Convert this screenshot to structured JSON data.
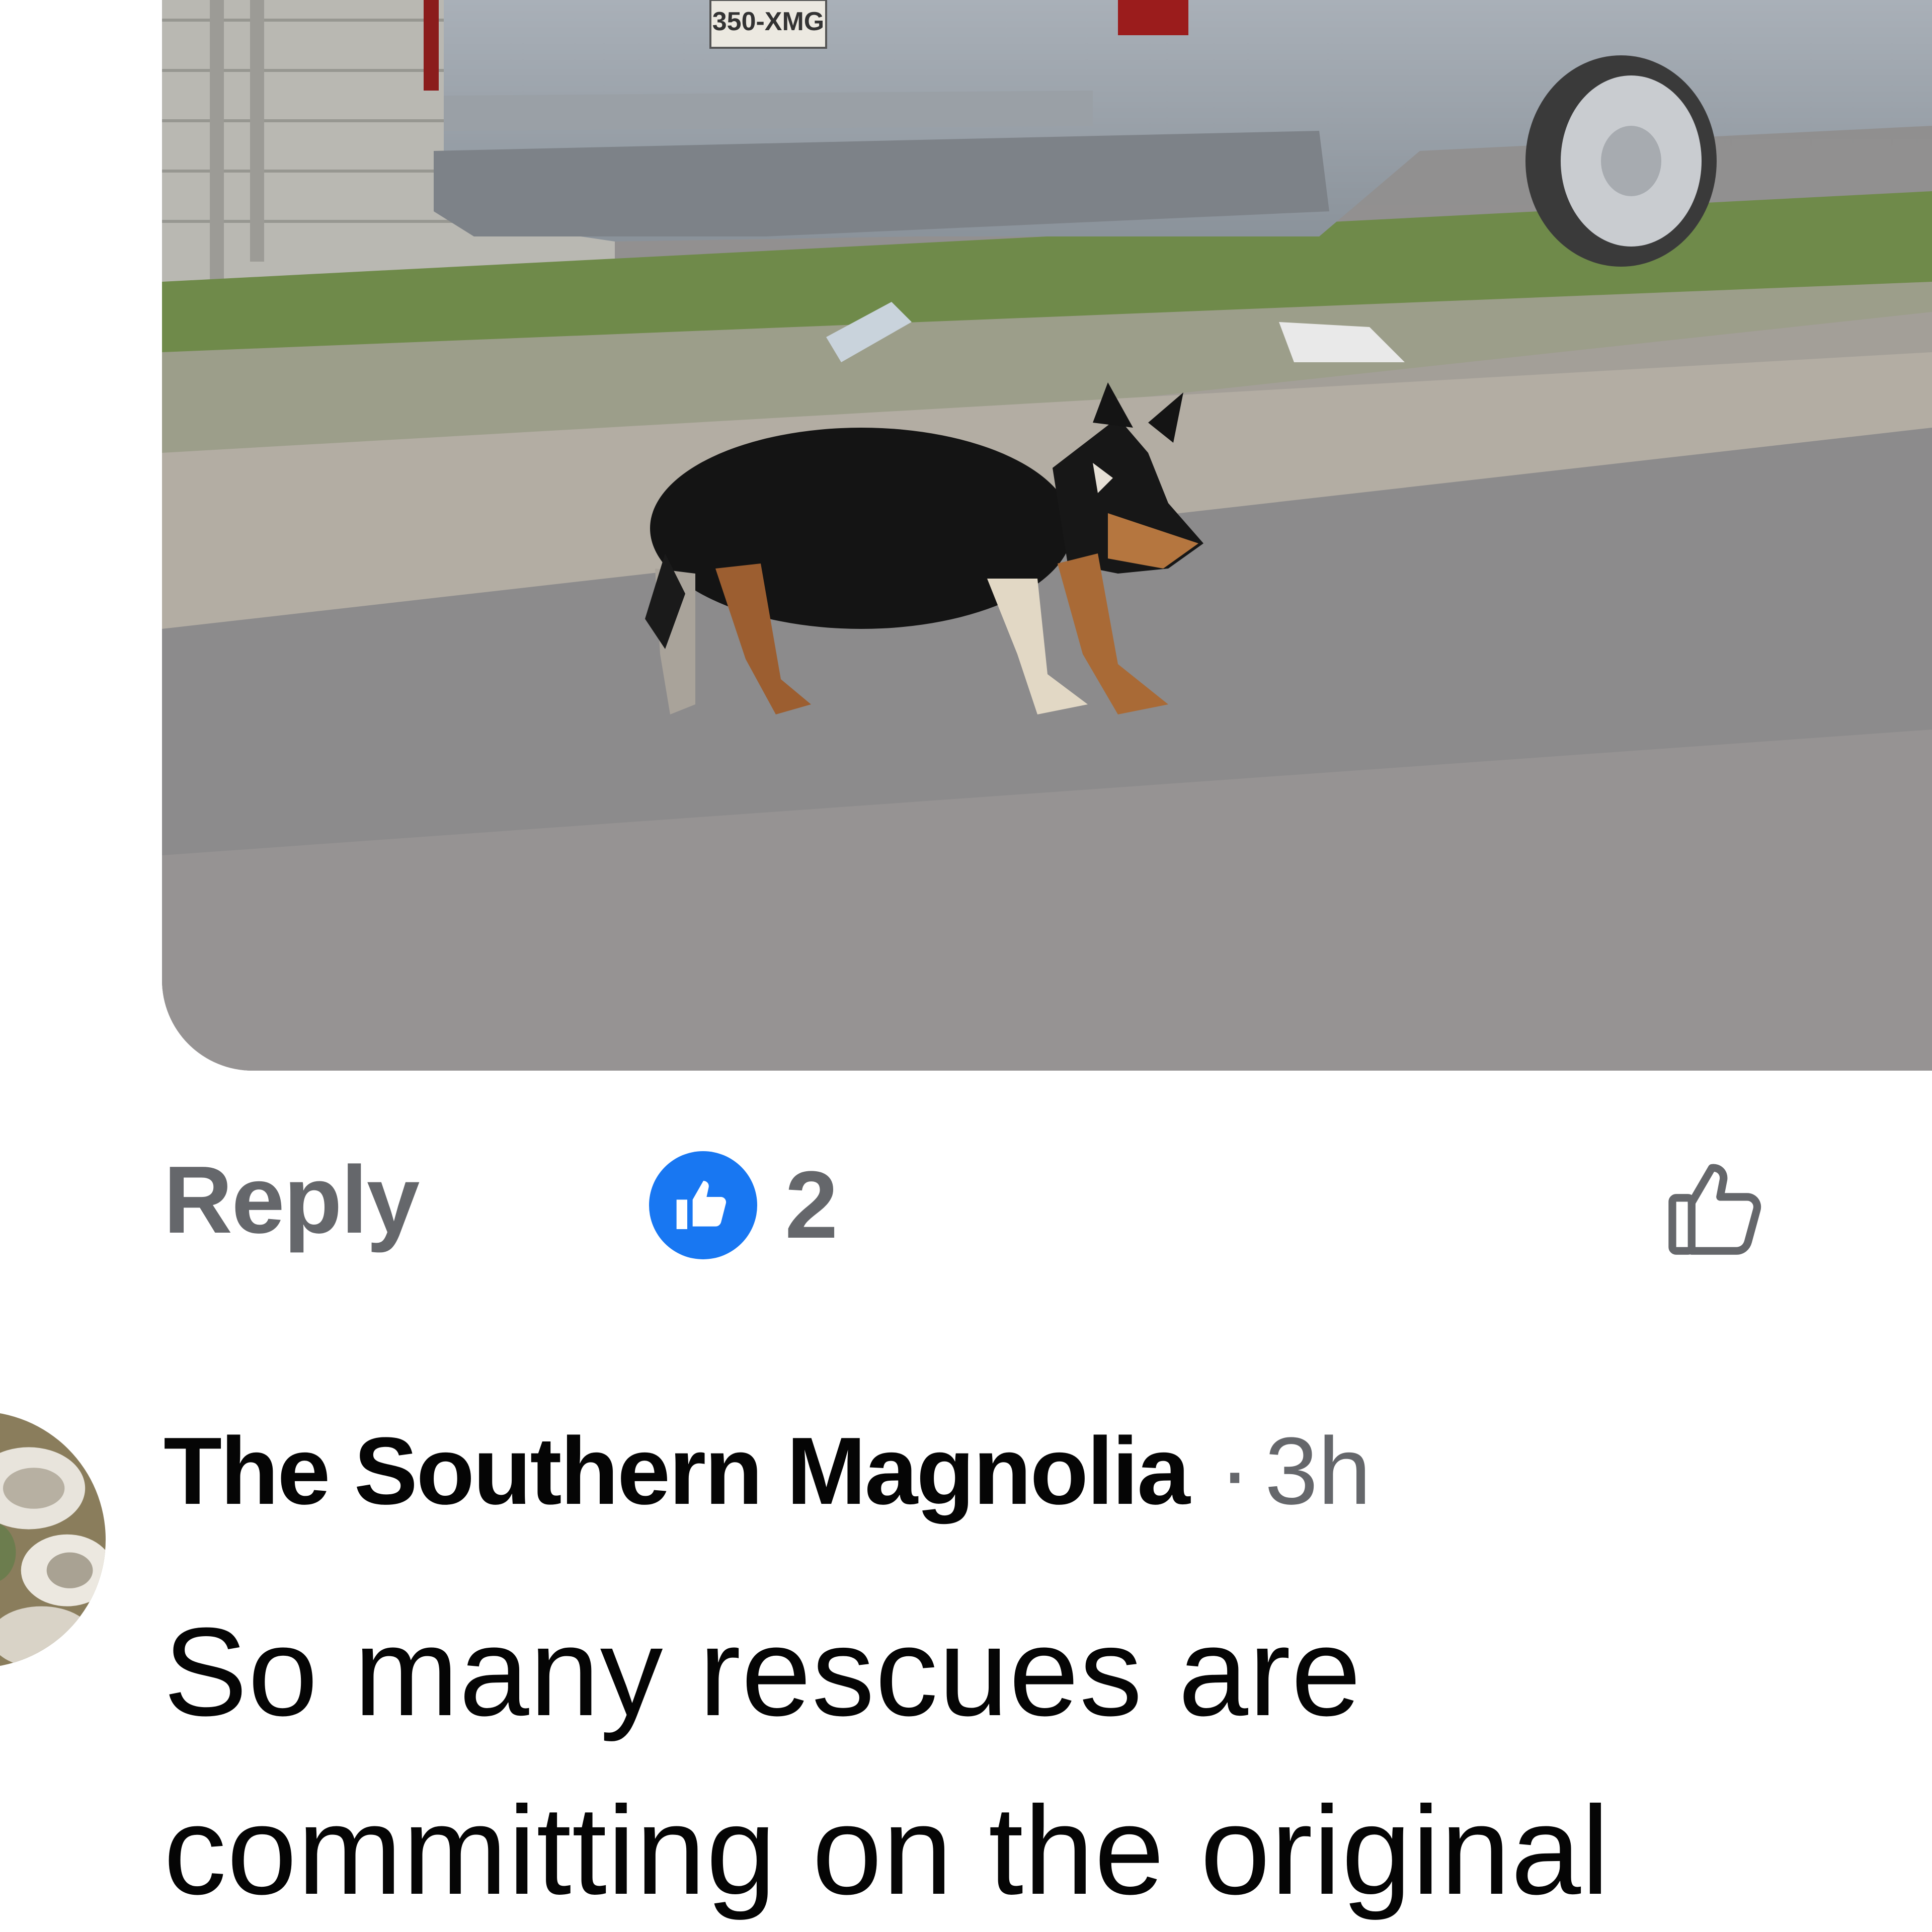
{
  "photo": {
    "plate_text": "350-XMG"
  },
  "actions": {
    "reply_label": "Reply",
    "reaction_type": "like-icon",
    "reaction_count": "2",
    "reaction_color": "#1877f2"
  },
  "comment": {
    "author": "The Southern Magnolia",
    "separator": "·",
    "timestamp": "3h",
    "text_lines": [
      "So many rescues are",
      "committing on the original"
    ]
  },
  "colors": {
    "secondary_text": "#65676b",
    "primary_text": "#050505"
  }
}
